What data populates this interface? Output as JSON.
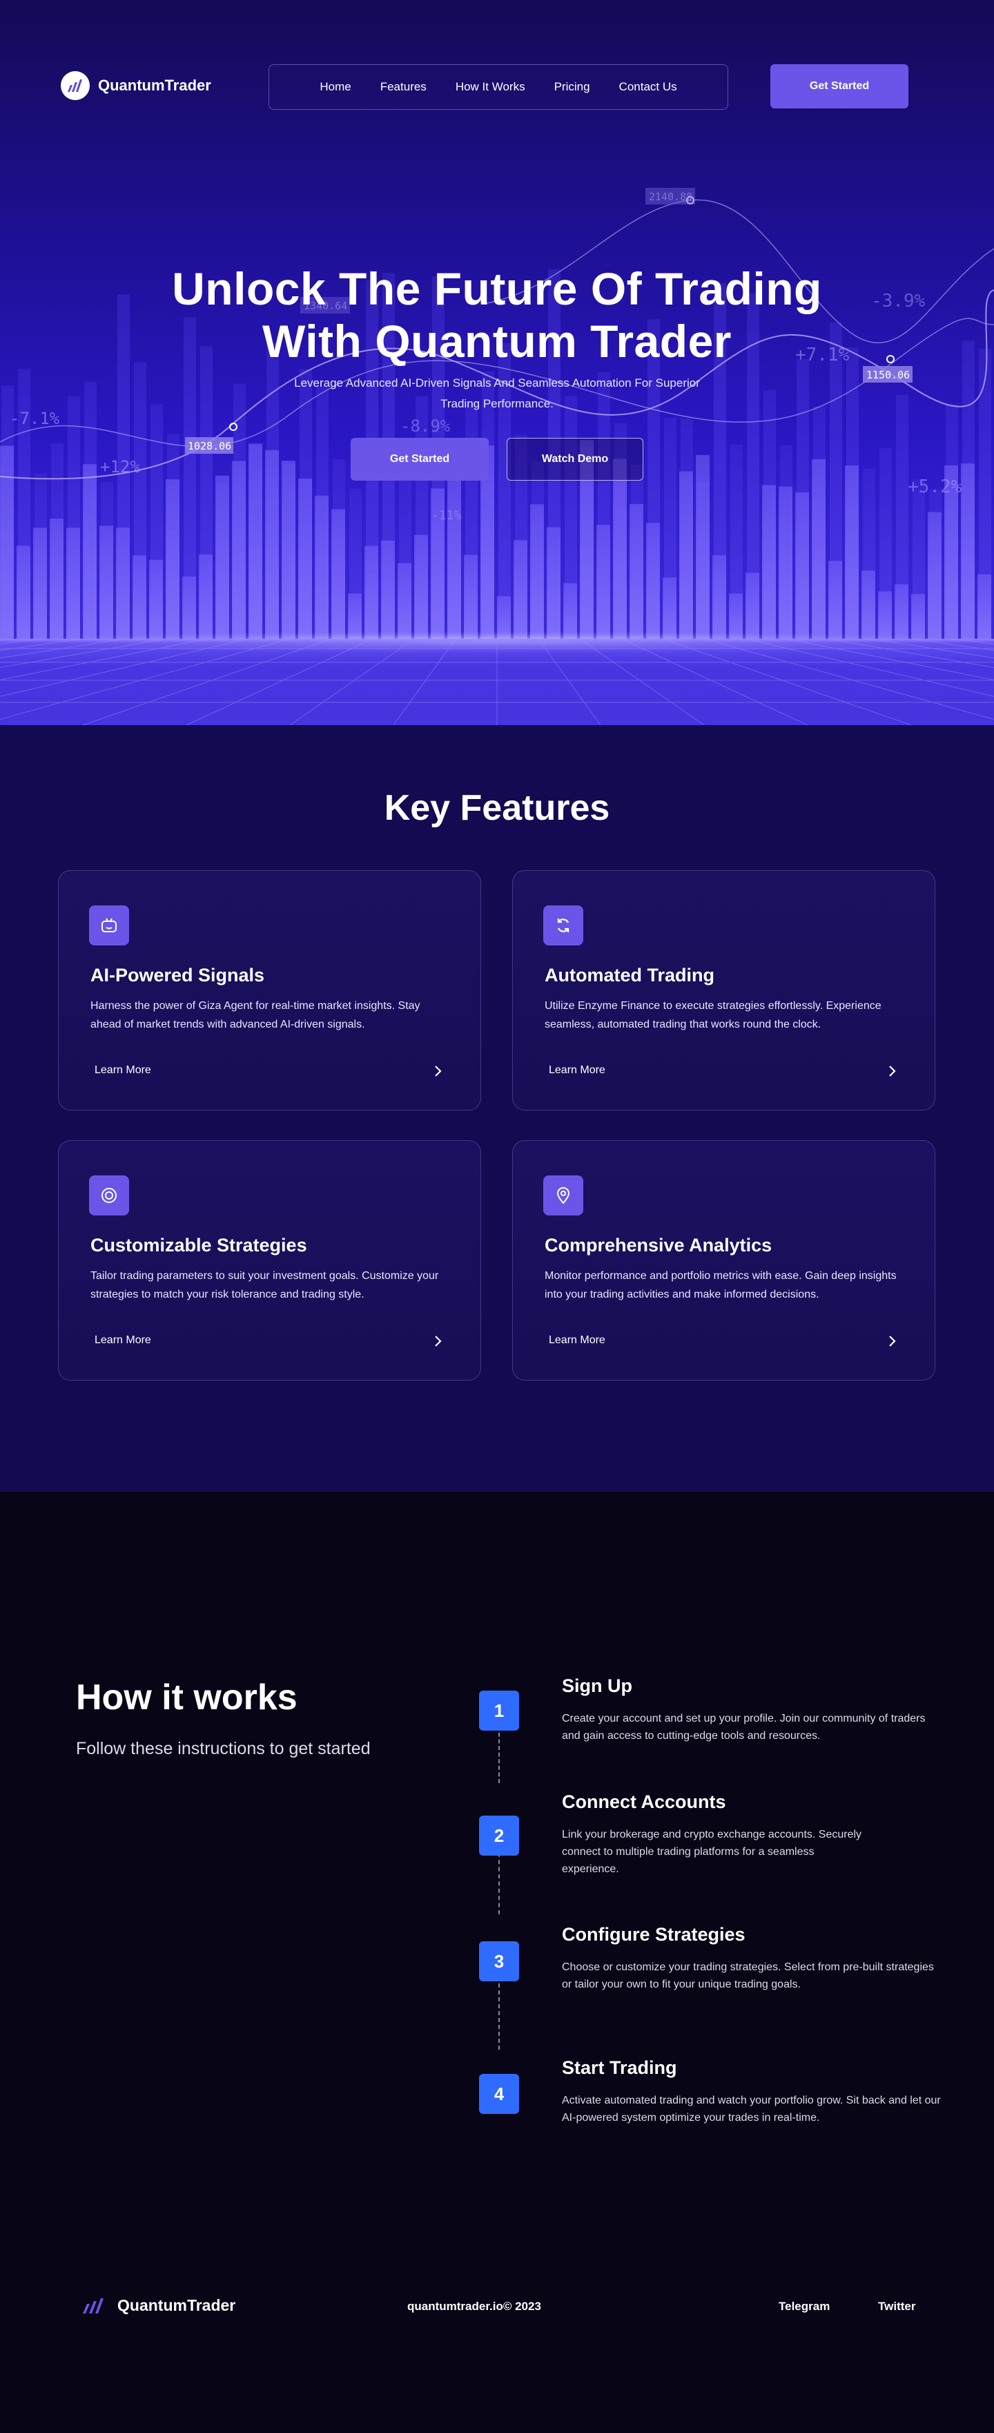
{
  "nav": {
    "brand": "QuantumTrader",
    "links": [
      "Home",
      "Features",
      "How It Works",
      "Pricing",
      "Contact Us"
    ],
    "cta": "Get Started"
  },
  "hero": {
    "title_line1": "Unlock The Future Of Trading",
    "title_line2": "With Quantum Trader",
    "subtitle": "Leverage Advanced AI-Driven Signals And Seamless Automation For Superior Trading Performance.",
    "primary_btn": "Get Started",
    "secondary_btn": "Watch Demo",
    "chart_labels": [
      "-7.1%",
      "+12%",
      "1028.06",
      "-8.9%",
      "-11%",
      "1340.64",
      "2140.88",
      "-3.9%",
      "+7.1%",
      "1150.06",
      "+5.2%"
    ]
  },
  "features": {
    "title": "Key Features",
    "cards": [
      {
        "icon": "robot-icon",
        "title": "AI-Powered Signals",
        "text": "Harness the power of Giza Agent for real-time market insights. Stay ahead of market trends with advanced AI-driven signals.",
        "link": "Learn More"
      },
      {
        "icon": "refresh-icon",
        "title": "Automated Trading",
        "text": "Utilize Enzyme Finance to execute strategies effortlessly. Experience seamless, automated trading that works round the clock.",
        "link": "Learn More"
      },
      {
        "icon": "target-icon",
        "title": "Customizable Strategies",
        "text": "Tailor trading parameters to suit your investment goals. Customize your strategies to match your risk tolerance and trading style.",
        "link": "Learn More"
      },
      {
        "icon": "map-pin-icon",
        "title": "Comprehensive Analytics",
        "text": "Monitor performance and portfolio metrics with ease. Gain deep insights into your trading activities and make informed decisions.",
        "link": "Learn More"
      }
    ]
  },
  "how": {
    "title": "How it works",
    "subtitle": "Follow these instructions to get started",
    "steps": [
      {
        "num": "1",
        "title": "Sign Up",
        "text": "Create your account and set up your profile. Join our community of traders and gain access to cutting-edge tools and resources."
      },
      {
        "num": "2",
        "title": "Connect Accounts",
        "text": "Link your brokerage and crypto exchange accounts. Securely connect to multiple trading platforms for a seamless experience."
      },
      {
        "num": "3",
        "title": "Configure Strategies",
        "text": "Choose or customize your trading strategies. Select from pre-built strategies or tailor your own to fit your unique trading goals."
      },
      {
        "num": "4",
        "title": "Start Trading",
        "text": "Activate automated trading and watch your portfolio grow. Sit back and let our AI-powered system optimize your trades in real-time."
      }
    ]
  },
  "footer": {
    "brand": "QuantumTrader",
    "copyright": "quantumtrader.io© 2023",
    "links": [
      "Telegram",
      "Twitter"
    ]
  },
  "colors": {
    "accent": "#6b55e8",
    "step_blue": "#2f6bff",
    "hero_bg": "#1d0f8f",
    "features_bg": "#140a52",
    "how_bg": "#070516"
  }
}
